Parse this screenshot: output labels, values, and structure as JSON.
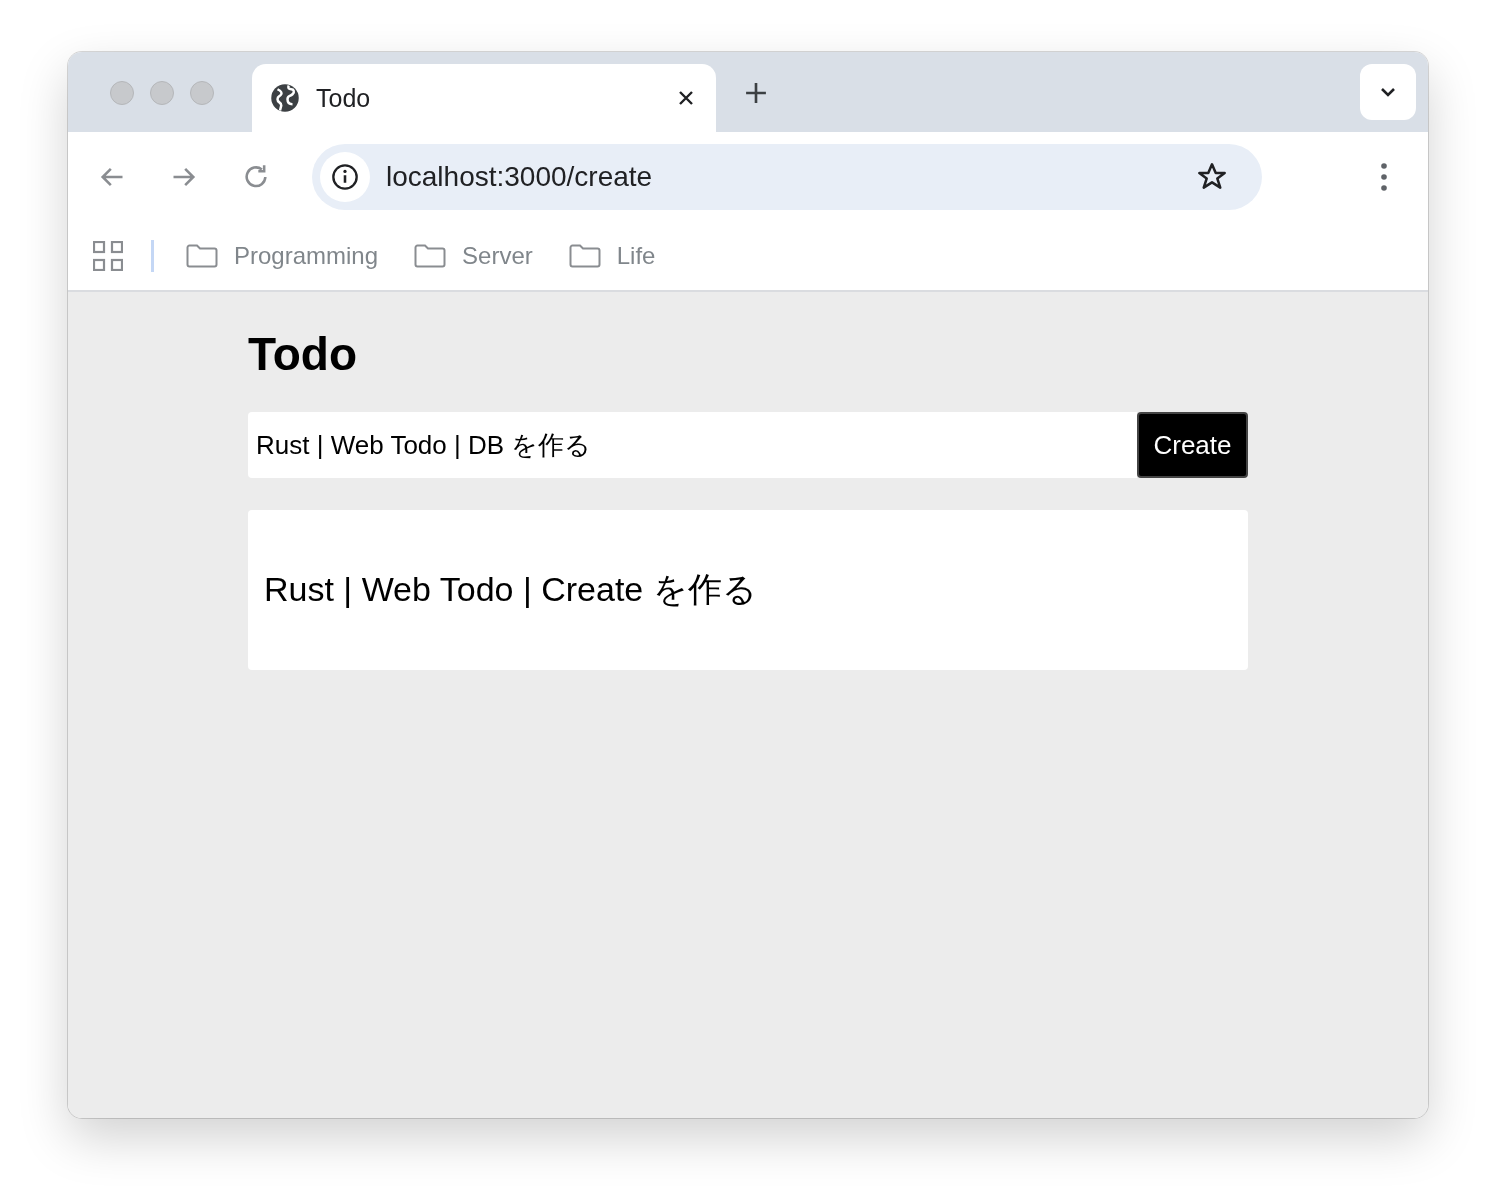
{
  "browser": {
    "tabs": [
      {
        "title": "Todo",
        "selected": true
      }
    ],
    "address": "localhost:3000/create",
    "bookmarks": [
      {
        "label": "Programming"
      },
      {
        "label": "Server"
      },
      {
        "label": "Life"
      }
    ]
  },
  "page": {
    "heading": "Todo",
    "form": {
      "value": "Rust | Web Todo | DB を作る",
      "button": "Create"
    },
    "todos": [
      {
        "text": "Rust | Web Todo | Create を作る"
      }
    ]
  }
}
